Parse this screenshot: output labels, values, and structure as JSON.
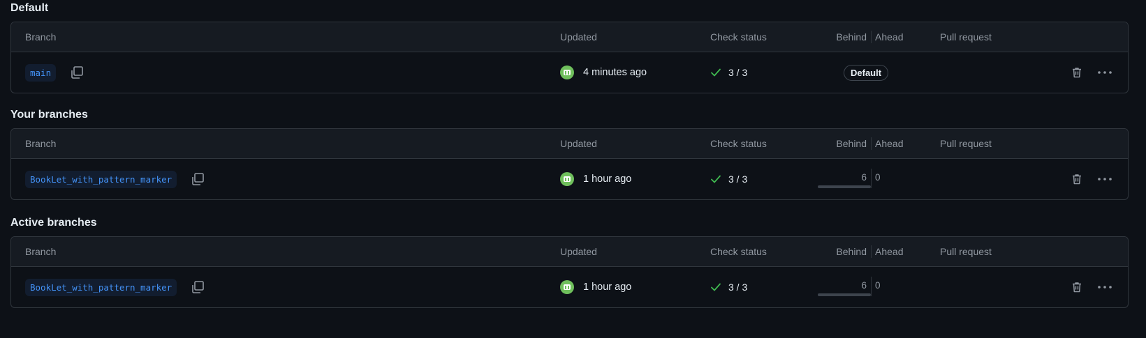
{
  "columns": {
    "branch": "Branch",
    "updated": "Updated",
    "check_status": "Check status",
    "behind": "Behind",
    "ahead": "Ahead",
    "pull_request": "Pull request"
  },
  "sections": [
    {
      "title": "Default",
      "row": {
        "branch": "main",
        "updated": "4 minutes ago",
        "check": "3 / 3",
        "badge": "Default"
      }
    },
    {
      "title": "Your branches",
      "row": {
        "branch": "BookLet_with_pattern_marker",
        "updated": "1 hour ago",
        "check": "3 / 3",
        "behind": "6",
        "ahead": "0"
      }
    },
    {
      "title": "Active branches",
      "row": {
        "branch": "BookLet_with_pattern_marker",
        "updated": "1 hour ago",
        "check": "3 / 3",
        "behind": "6",
        "ahead": "0"
      }
    }
  ],
  "colors": {
    "background": "#0d1117",
    "header": "#161b22",
    "border": "#30363d",
    "link": "#4493f8",
    "success": "#3fb950",
    "avatar": "#6fbf5c"
  },
  "icons": [
    "copy-icon",
    "avatar-icon",
    "check-icon",
    "trash-icon",
    "kebab-icon"
  ]
}
